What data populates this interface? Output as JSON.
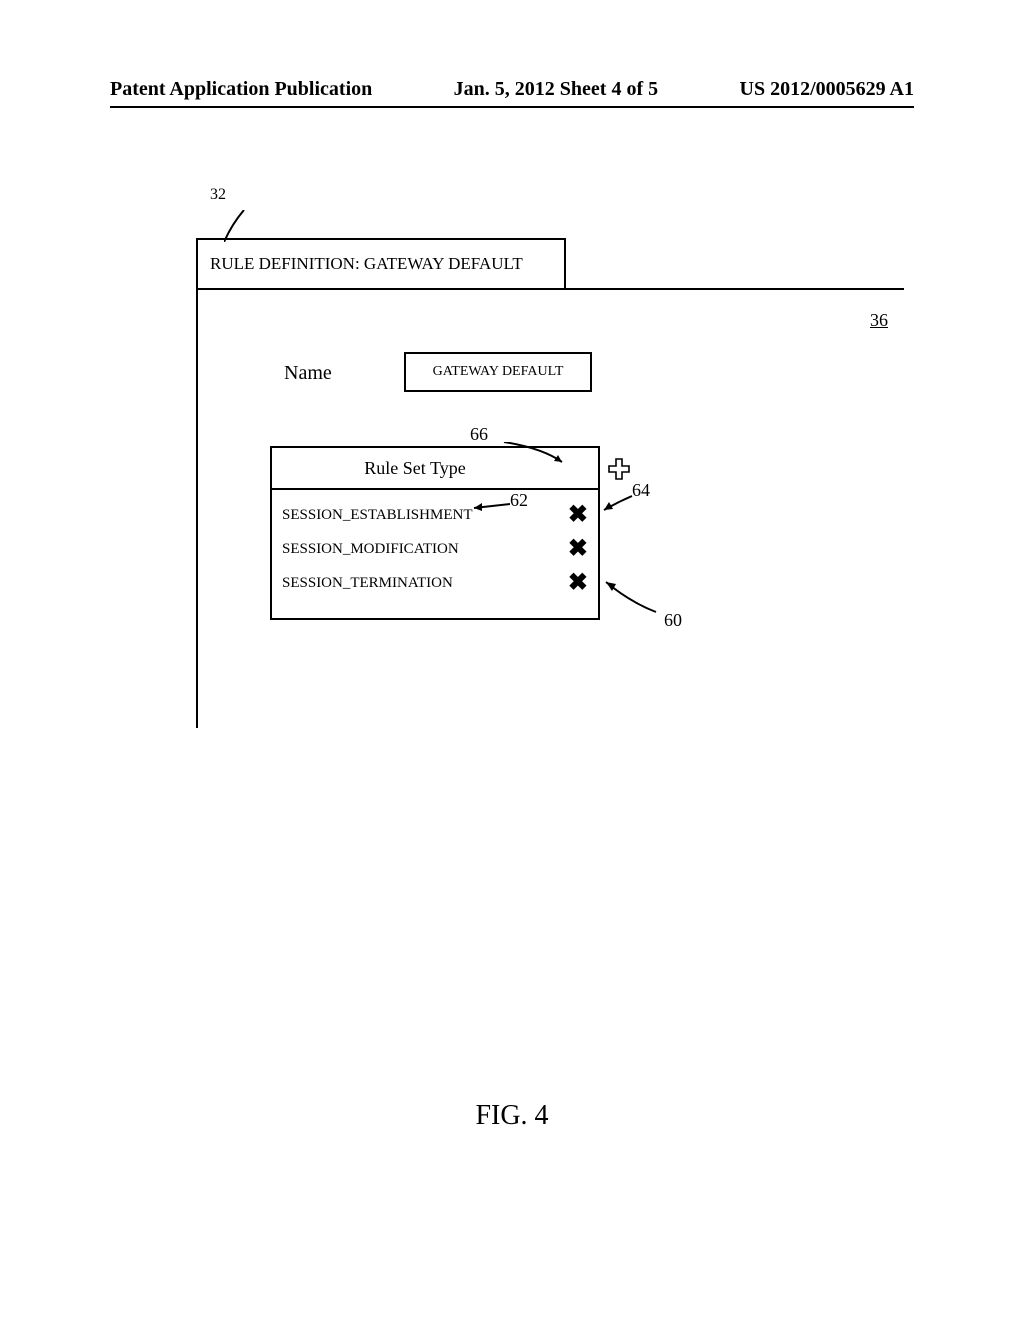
{
  "header": {
    "left": "Patent Application Publication",
    "center": "Jan. 5, 2012  Sheet 4 of 5",
    "right": "US 2012/0005629 A1"
  },
  "refs": {
    "r32": "32",
    "r36": "36",
    "r60": "60",
    "r62": "62",
    "r64": "64",
    "r66": "66"
  },
  "panel": {
    "title": "RULE DEFINITION: GATEWAY DEFAULT",
    "name_label": "Name",
    "name_value": "GATEWAY DEFAULT",
    "ruleset_header": "Rule Set Type",
    "rows": [
      {
        "label": "SESSION_ESTABLISHMENT"
      },
      {
        "label": "SESSION_MODIFICATION"
      },
      {
        "label": "SESSION_TERMINATION"
      }
    ]
  },
  "caption": "FIG. 4"
}
